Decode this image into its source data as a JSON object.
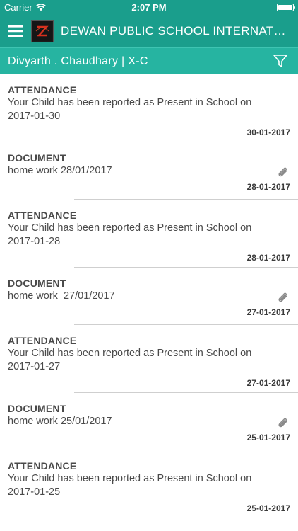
{
  "status_bar": {
    "carrier": "Carrier",
    "time": "2:07 PM"
  },
  "app_bar": {
    "title": "DEWAN PUBLIC SCHOOL INTERNATIONAL"
  },
  "sub_bar": {
    "student": "Divyarth . Chaudhary | X-C"
  },
  "colors": {
    "primary": "#1a9e8c",
    "secondary": "#26b4a1"
  },
  "feed": [
    {
      "type": "ATTENDANCE",
      "text": "Your Child has been reported as Present in School on 2017-01-30",
      "date": "30-01-2017",
      "attachment": false
    },
    {
      "type": "DOCUMENT",
      "text": "home work 28/01/2017",
      "date": "28-01-2017",
      "attachment": true
    },
    {
      "type": "ATTENDANCE",
      "text": "Your Child has been reported as Present in School on 2017-01-28",
      "date": "28-01-2017",
      "attachment": false
    },
    {
      "type": "DOCUMENT",
      "text": "home work  27/01/2017",
      "date": "27-01-2017",
      "attachment": true
    },
    {
      "type": "ATTENDANCE",
      "text": "Your Child has been reported as Present in School on 2017-01-27",
      "date": "27-01-2017",
      "attachment": false
    },
    {
      "type": "DOCUMENT",
      "text": "home work 25/01/2017",
      "date": "25-01-2017",
      "attachment": true
    },
    {
      "type": "ATTENDANCE",
      "text": "Your Child has been reported as Present in School on 2017-01-25",
      "date": "25-01-2017",
      "attachment": false
    }
  ]
}
